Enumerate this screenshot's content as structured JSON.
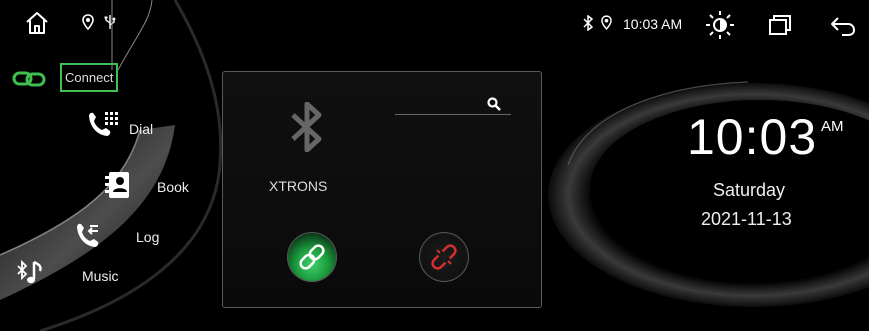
{
  "status_bar": {
    "time": "10:03 AM",
    "icons": [
      "home-icon",
      "location-icon",
      "usb-icon",
      "bluetooth-icon",
      "location-icon",
      "brightness-icon",
      "recent-apps-icon",
      "back-icon"
    ]
  },
  "menu": {
    "items": [
      {
        "label": "Connect",
        "icon": "link-icon",
        "selected": true
      },
      {
        "label": "Dial",
        "icon": "dialpad-icon"
      },
      {
        "label": "Book",
        "icon": "contacts-icon"
      },
      {
        "label": "Log",
        "icon": "call-log-icon"
      },
      {
        "label": "Music",
        "icon": "bluetooth-music-icon"
      }
    ]
  },
  "device_panel": {
    "device_name": "XTRONS",
    "search_icon": "search-icon",
    "connect_button_icon": "link-icon",
    "disconnect_button_icon": "unlink-icon"
  },
  "clock": {
    "time": "10:03",
    "ampm": "AM",
    "day": "Saturday",
    "date": "2021-11-13"
  },
  "colors": {
    "accent_green": "#3fbf4f",
    "disconnect_red": "#d23030",
    "background": "#000000"
  }
}
